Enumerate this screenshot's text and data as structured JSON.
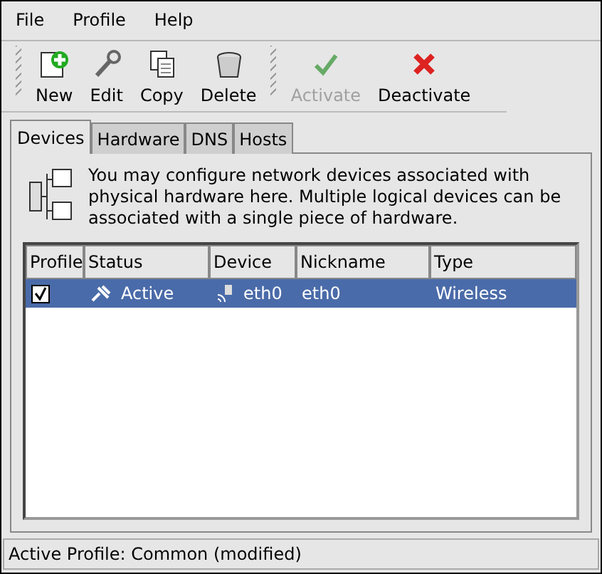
{
  "menu": [
    "File",
    "Profile",
    "Help"
  ],
  "toolbar": [
    {
      "label": "New",
      "kind": "new",
      "disabled": false
    },
    {
      "label": "Edit",
      "kind": "edit",
      "disabled": false
    },
    {
      "label": "Copy",
      "kind": "copy",
      "disabled": false
    },
    {
      "label": "Delete",
      "kind": "delete",
      "disabled": false
    },
    {
      "label": "Activate",
      "kind": "activate",
      "disabled": true
    },
    {
      "label": "Deactivate",
      "kind": "deactivate",
      "disabled": false
    }
  ],
  "tabs": [
    {
      "label": "Devices",
      "selected": true
    },
    {
      "label": "Hardware",
      "selected": false
    },
    {
      "label": "DNS",
      "selected": false
    },
    {
      "label": "Hosts",
      "selected": false
    }
  ],
  "description": "You may configure network devices associated with physical hardware here.  Multiple logical devices can be associated with a single piece of hardware.",
  "table": {
    "columns": [
      "Profile",
      "Status",
      "Device",
      "Nickname",
      "Type"
    ],
    "rows": [
      {
        "checked": true,
        "selected": true,
        "status": "Active",
        "device": "eth0",
        "nickname": "eth0",
        "type": "Wireless"
      }
    ]
  },
  "status_bar": "Active Profile: Common (modified)"
}
